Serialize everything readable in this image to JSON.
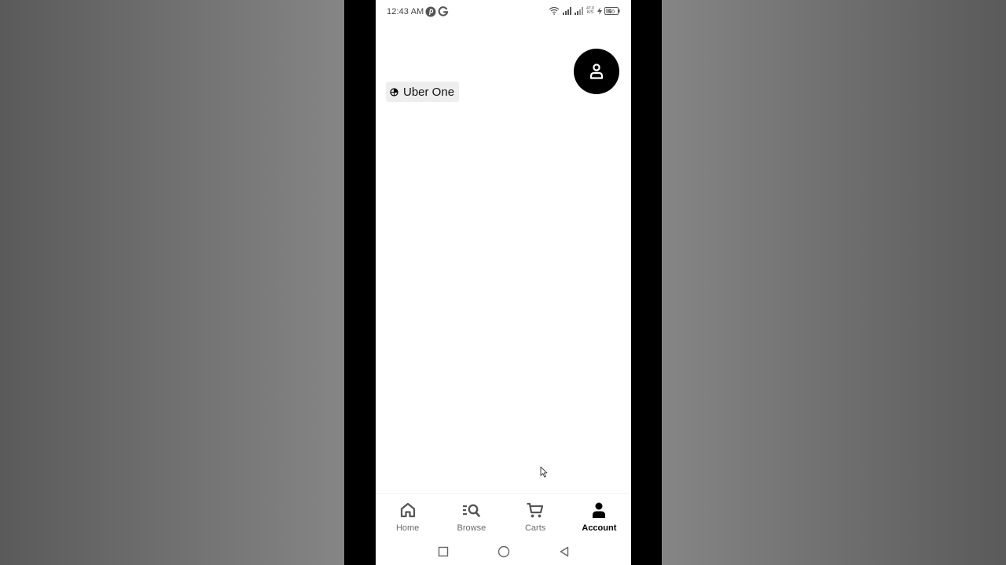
{
  "status_bar": {
    "time": "12:43 AM",
    "app_icons": [
      "pinterest-icon",
      "google-icon"
    ],
    "network_speed_value": "47.0",
    "network_speed_unit": "K/S",
    "battery_level": "50",
    "system_icons": [
      "wifi-icon",
      "signal-icon",
      "signal-icon",
      "charging-icon",
      "battery-icon"
    ]
  },
  "profile": {
    "avatar_icon": "person-icon"
  },
  "uber_one": {
    "label": "Uber One",
    "icon": "uber-one-icon"
  },
  "bottom_nav": {
    "items": [
      {
        "label": "Home",
        "icon": "home-icon",
        "active": false
      },
      {
        "label": "Browse",
        "icon": "browse-icon",
        "active": false
      },
      {
        "label": "Carts",
        "icon": "cart-icon",
        "active": false
      },
      {
        "label": "Account",
        "icon": "account-icon",
        "active": true
      }
    ]
  },
  "system_nav": {
    "buttons": [
      "recents-button",
      "home-button",
      "back-button"
    ]
  },
  "colors": {
    "screen_background": "#ffffff",
    "avatar_background": "#000000",
    "chip_background": "#eeeeee",
    "inactive_nav": "#6b6b6b",
    "active_nav": "#000000"
  }
}
